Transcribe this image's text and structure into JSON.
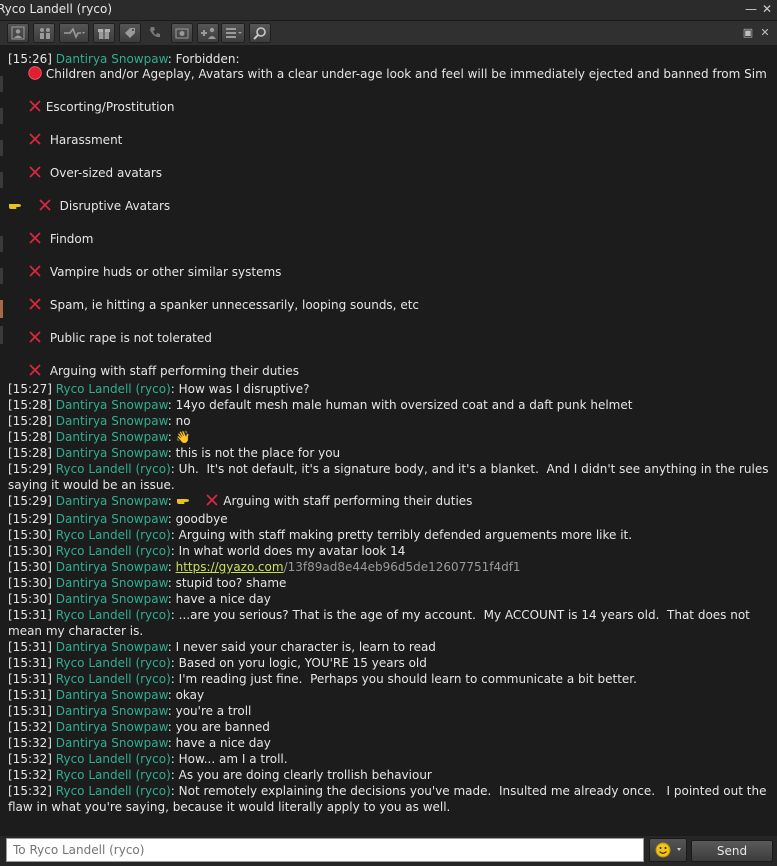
{
  "window": {
    "title": "Ryco Landell (ryco)",
    "minimize": "—",
    "close": "✕"
  },
  "forbidden": {
    "ts": "[15:26]",
    "name": "Dantirya Snowpaw",
    "text": ": Forbidden:",
    "items": [
      "Children and/or Ageplay, Avatars with a clear under-age look and feel will be immediately ejected and banned from Sim",
      "Escorting/Prostitution",
      "Harassment",
      "Over-sized avatars",
      "Disruptive Avatars",
      "Findom",
      "Vampire huds or other similar systems",
      "Spam, ie hitting a spanker unnecessarily, looping sounds, etc",
      "Public rape is not tolerated",
      "Arguing with staff performing their duties"
    ]
  },
  "messages": [
    {
      "ts": "[15:27]",
      "name": "Ryco Landell (ryco)",
      "text": ": How was I disruptive?"
    },
    {
      "ts": "[15:28]",
      "name": "Dantirya Snowpaw",
      "text": ": 14yo default mesh male human with oversized coat and a daft punk helmet"
    },
    {
      "ts": "[15:28]",
      "name": "Dantirya Snowpaw",
      "text": ": no"
    },
    {
      "ts": "[15:28]",
      "name": "Dantirya Snowpaw",
      "text": ": 👋"
    },
    {
      "ts": "[15:28]",
      "name": "Dantirya Snowpaw",
      "text": ": this is not the place for you"
    },
    {
      "ts": "[15:29]",
      "name": "Ryco Landell (ryco)",
      "text": ": Uh.  It's not default, it's a signature body, and it's a blanket.  And I didn't see anything in the rules saying it would be an issue."
    },
    {
      "ts": "[15:29]",
      "name": "Dantirya Snowpaw",
      "text": ":",
      "rule": "Arguing with staff performing their duties"
    },
    {
      "ts": "[15:29]",
      "name": "Dantirya Snowpaw",
      "text": ": goodbye"
    },
    {
      "ts": "[15:30]",
      "name": "Ryco Landell (ryco)",
      "text": ": Arguing with staff making pretty terribly defended arguements more like it."
    },
    {
      "ts": "[15:30]",
      "name": "Ryco Landell (ryco)",
      "text": ": In what world does my avatar look 14"
    },
    {
      "ts": "[15:30]",
      "name": "Dantirya Snowpaw",
      "text": ": ",
      "link": "https://gyazo.com",
      "linkhash": "/13f89ad8e44eb96d5de12607751f4df1"
    },
    {
      "ts": "[15:30]",
      "name": "Dantirya Snowpaw",
      "text": ": stupid too? shame"
    },
    {
      "ts": "[15:30]",
      "name": "Dantirya Snowpaw",
      "text": ": have a nice day"
    },
    {
      "ts": "[15:31]",
      "name": "Ryco Landell (ryco)",
      "text": ": ...are you serious? That is the age of my account.  My ACCOUNT is 14 years old.  That does not mean my character is."
    },
    {
      "ts": "[15:31]",
      "name": "Dantirya Snowpaw",
      "text": ": I never said your character is, learn to read"
    },
    {
      "ts": "[15:31]",
      "name": "Ryco Landell (ryco)",
      "text": ": Based on yoru logic, YOU'RE 15 years old"
    },
    {
      "ts": "[15:31]",
      "name": "Ryco Landell (ryco)",
      "text": ": I'm reading just fine.  Perhaps you should learn to communicate a bit better."
    },
    {
      "ts": "[15:31]",
      "name": "Dantirya Snowpaw",
      "text": ": okay"
    },
    {
      "ts": "[15:31]",
      "name": "Dantirya Snowpaw",
      "text": ": you're a troll"
    },
    {
      "ts": "[15:32]",
      "name": "Dantirya Snowpaw",
      "text": ": you are banned"
    },
    {
      "ts": "[15:32]",
      "name": "Dantirya Snowpaw",
      "text": ": have a nice day"
    },
    {
      "ts": "[15:32]",
      "name": "Ryco Landell (ryco)",
      "text": ": How... am I a troll."
    },
    {
      "ts": "[15:32]",
      "name": "Ryco Landell (ryco)",
      "text": ": As you are doing clearly trollish behaviour"
    },
    {
      "ts": "[15:32]",
      "name": "Ryco Landell (ryco)",
      "text": ": Not remotely explaining the decisions you've made.  Insulted me already once.   I pointed out the flaw in what you're saying, because it would literally apply to you as well."
    }
  ],
  "input": {
    "placeholder": "To Ryco Landell (ryco)",
    "send_label": "Send"
  },
  "colors": {
    "name": "#2faf8f",
    "link": "#c8e05c",
    "rule_x": "#d8283c",
    "no_entry": "#e02030"
  },
  "icons": [
    "profile-icon",
    "friends-icon",
    "call-icon",
    "gift-icon",
    "tag-icon",
    "phone-icon",
    "snapshot-icon",
    "add-friend-icon",
    "list-icon",
    "search-icon",
    "undock-icon",
    "close-icon",
    "no-entry-icon",
    "cross-icon",
    "pointing-hand-icon",
    "waving-hand-icon",
    "smiley-icon"
  ]
}
